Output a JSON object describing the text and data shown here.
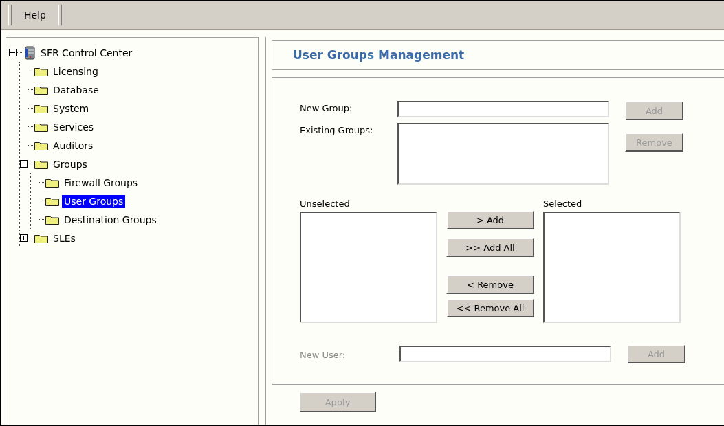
{
  "menu": [
    "Help"
  ],
  "tree": [
    {
      "label": "SFR Control Center",
      "kind": "server",
      "expanded": true,
      "selected": false,
      "children": [
        {
          "label": "Licensing",
          "kind": "folder",
          "selected": false
        },
        {
          "label": "Database",
          "kind": "folder",
          "selected": false
        },
        {
          "label": "System",
          "kind": "folder",
          "selected": false
        },
        {
          "label": "Services",
          "kind": "folder",
          "selected": false
        },
        {
          "label": "Auditors",
          "kind": "folder",
          "selected": false
        },
        {
          "label": "Groups",
          "kind": "folder",
          "expanded": true,
          "selected": false,
          "children": [
            {
              "label": "Firewall Groups",
              "kind": "folder",
              "selected": false
            },
            {
              "label": "User Groups",
              "kind": "folder",
              "selected": true
            },
            {
              "label": "Destination Groups",
              "kind": "folder",
              "selected": false
            }
          ]
        },
        {
          "label": "SLEs",
          "kind": "folder",
          "expanded": false,
          "selected": false
        }
      ]
    }
  ],
  "title": "User Groups Management",
  "new_group": {
    "label": "New Group:",
    "button": {
      "label": "Add",
      "disabled": true
    }
  },
  "existing_groups": {
    "label": "Existing Groups:",
    "button": {
      "label": "Remove",
      "disabled": true
    }
  },
  "unselected": {
    "label": "Unselected"
  },
  "selected": {
    "label": "Selected"
  },
  "transfer_buttons": [
    {
      "label": "> Add"
    },
    {
      "label": ">> Add All"
    },
    {
      "label": "< Remove"
    },
    {
      "label": "<< Remove All"
    }
  ],
  "new_user": {
    "label": "New User:",
    "disabled": true,
    "button": {
      "label": "Add",
      "disabled": true
    }
  },
  "apply": {
    "label": "Apply",
    "disabled": true
  }
}
